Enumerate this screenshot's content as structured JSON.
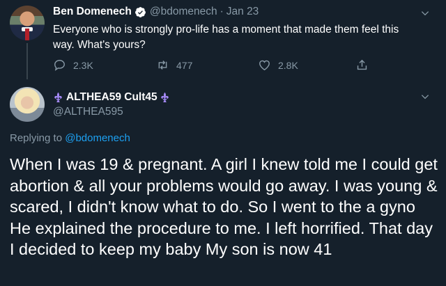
{
  "parent_tweet": {
    "display_name": "Ben Domenech",
    "handle": "@bdomenech",
    "separator": "·",
    "date": "Jan 23",
    "text": "Everyone who is strongly pro-life has a moment that made them feel this way. What's yours?",
    "actions": {
      "replies": "2.3K",
      "retweets": "477",
      "likes": "2.8K"
    }
  },
  "reply_tweet": {
    "display_name": "ALTHEA59 Cult45",
    "handle": "@ALTHEA595",
    "replying_prefix": "Replying to",
    "replying_to": "@bdomenech",
    "text": "When I was 19 & pregnant. A girl I knew told me I could get abortion & all your problems would go away. I was young & scared, I didn't know what to do. So I went to the a gyno He explained the procedure to me. I left horrified. That day I decided to keep my baby My son is now 41"
  },
  "icons": {
    "verified": "verified-badge-icon",
    "reply": "reply-icon",
    "retweet": "retweet-icon",
    "like": "heart-icon",
    "share": "share-icon",
    "caret": "chevron-down-icon",
    "fleur": "fleur-de-lis-icon"
  },
  "colors": {
    "background": "#15202b",
    "text": "#ffffff",
    "secondary": "#8899a6",
    "link": "#1da1f2",
    "fleur": "#a78bfa"
  }
}
